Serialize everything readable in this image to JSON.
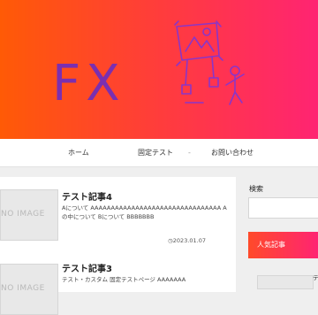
{
  "nav": {
    "items": [
      {
        "label": "ホーム"
      },
      {
        "label": "固定テスト"
      },
      {
        "label": "お問い合わせ"
      }
    ],
    "dropdown_marker": "-"
  },
  "hero": {
    "logo_text": "FX",
    "logo_color": "#7b2fb0",
    "gradient_colors": [
      "#ff5a06",
      "#ff3f36",
      "#ff2472"
    ]
  },
  "posts": [
    {
      "title": "テスト記事4",
      "excerpt": "Aについて AAAAAAAAAAAAAAAAAAAAAAAAAAAAAAAA Aの中について Bについて BBBBBBB",
      "date": "2023.01.07",
      "thumb_label": "NO IMAGE"
    },
    {
      "title": "テスト記事3",
      "excerpt": "テスト・カスタム 固定テストページ AAAAAAA",
      "thumb_label": "NO IMAGE"
    }
  ],
  "sidebar": {
    "search_label": "検索",
    "popular_title": "人気記事",
    "popular_item_text": "テ"
  },
  "icons": {
    "date_icon": "clock-icon"
  }
}
